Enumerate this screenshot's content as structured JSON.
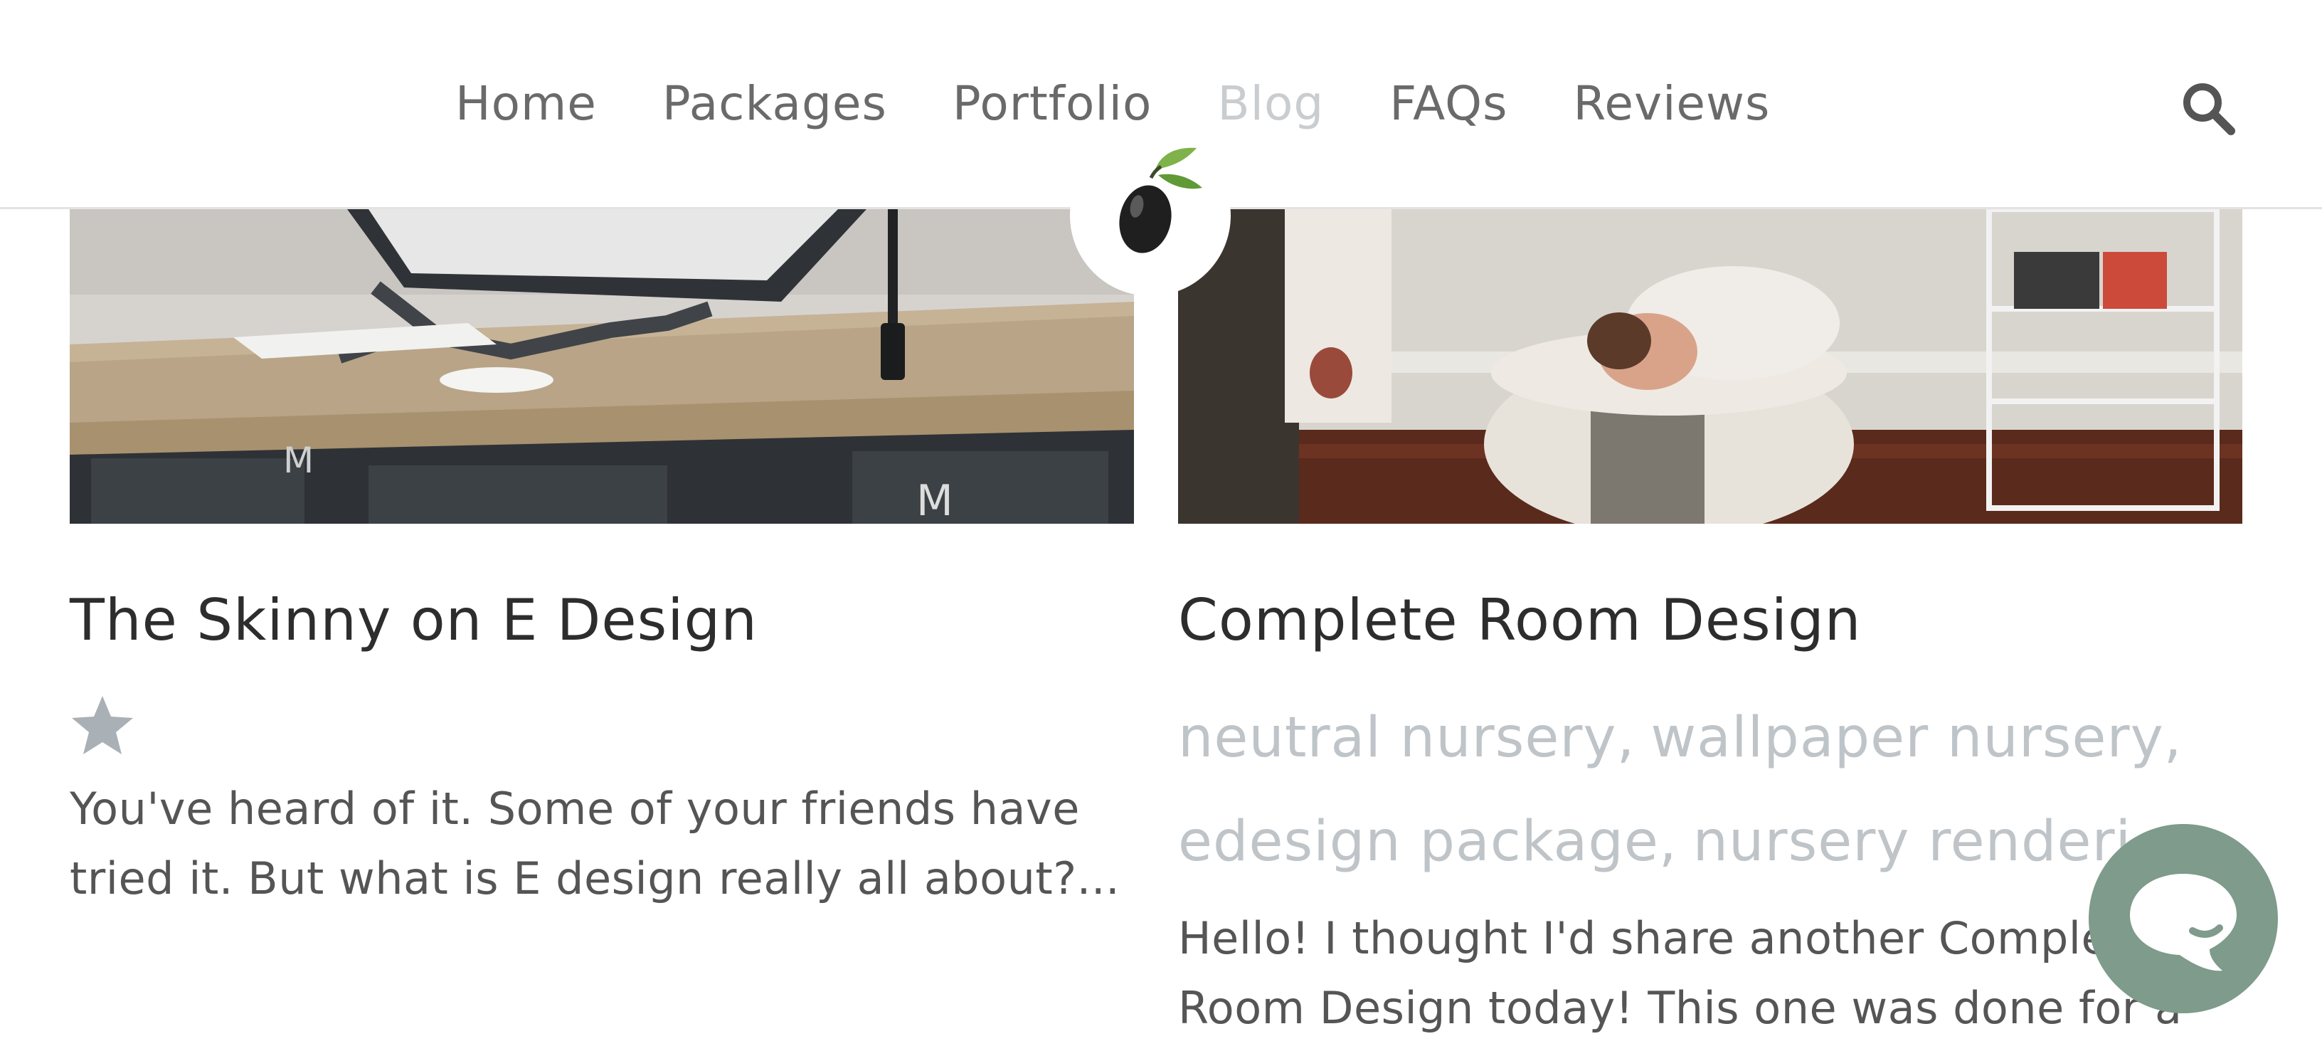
{
  "nav": {
    "items": [
      {
        "label": "Home",
        "active": false
      },
      {
        "label": "Packages",
        "active": false
      },
      {
        "label": "Portfolio",
        "active": false
      },
      {
        "label": "Blog",
        "active": true
      },
      {
        "label": "FAQs",
        "active": false
      },
      {
        "label": "Reviews",
        "active": false
      }
    ],
    "search_icon": "search-icon"
  },
  "logo": {
    "icon": "olive-icon"
  },
  "posts": [
    {
      "title": "The Skinny on E Design",
      "image": "desk-workspace-photo",
      "rating_icon": "star-icon",
      "excerpt": "You've heard of it. Some of your friends have tried it. But what is E design really all about?..."
    },
    {
      "title": "Complete Room Design",
      "image": "nursery-baby-photo",
      "tags": [
        "neutral nursery,",
        "wallpaper nursery,",
        "edesign package,",
        "nursery renderi"
      ],
      "excerpt": "Hello! I thought I'd share another Complete Room Design today! This one was done for a"
    }
  ],
  "chat": {
    "icon": "chat-bubble-icon"
  },
  "colors": {
    "nav_text": "#6a6a6a",
    "nav_active": "#c9cdd0",
    "tag_text": "#bfc4c8",
    "chat_bg": "#7e9b8b",
    "star": "#a9b0b6"
  }
}
